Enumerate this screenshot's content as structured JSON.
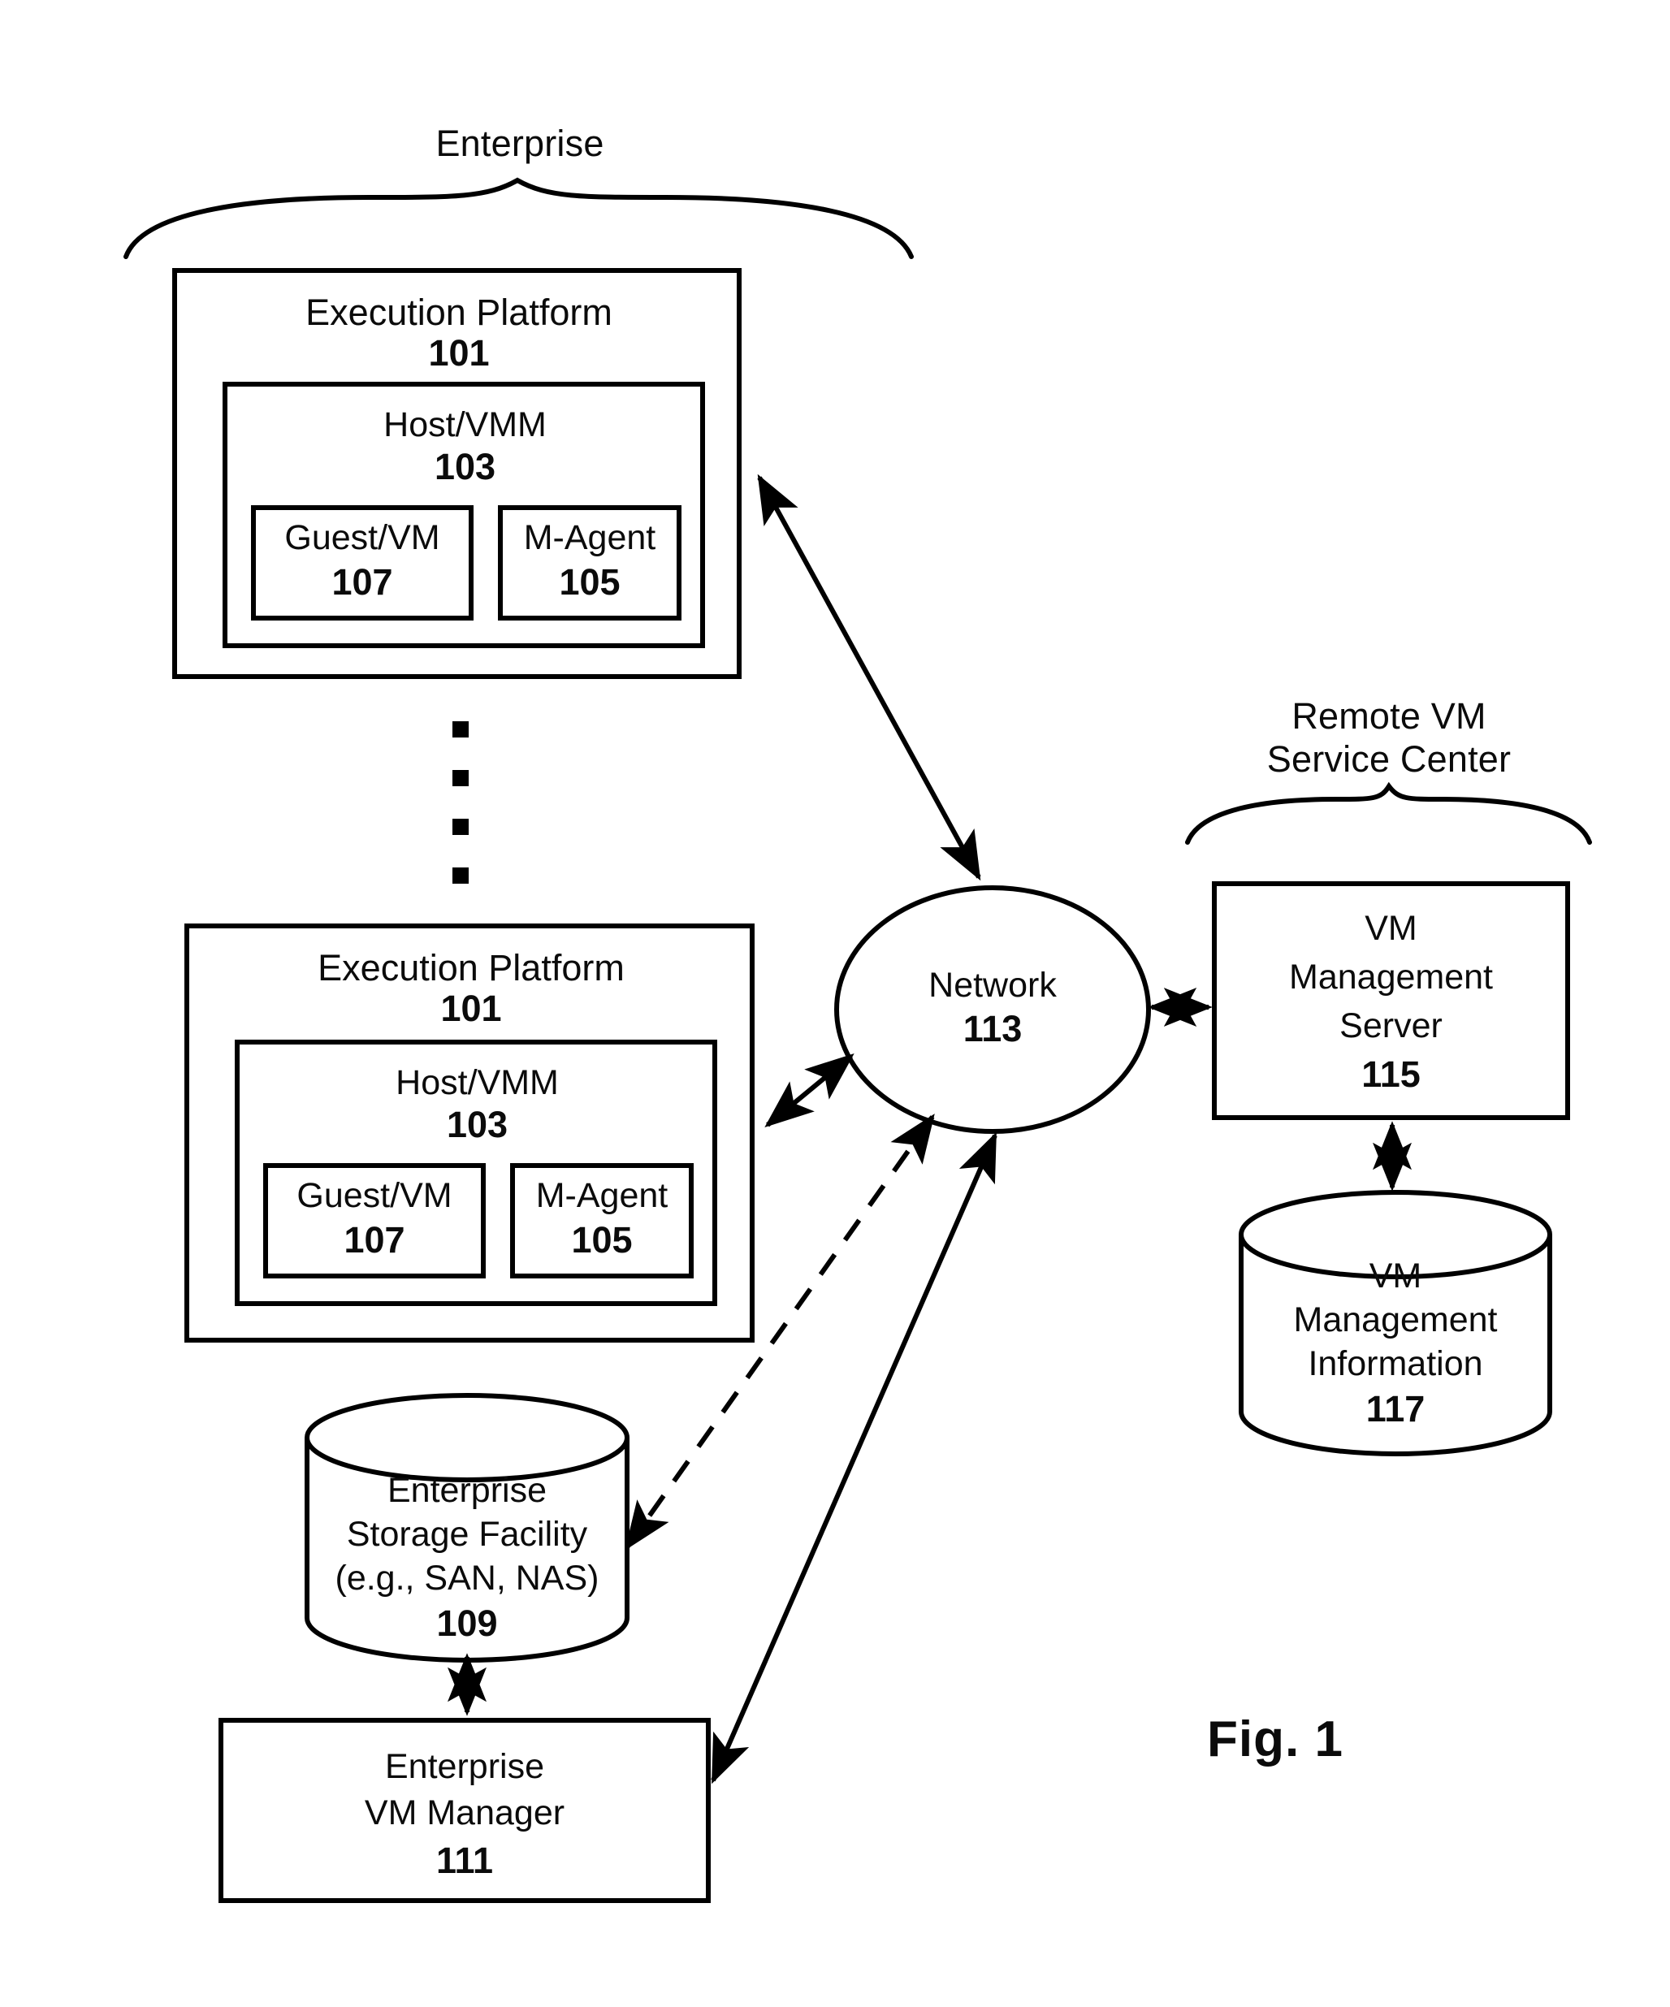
{
  "figure": {
    "label": "Fig. 1",
    "enterprise_group_label": "Enterprise",
    "remote_group_label_line1": "Remote VM",
    "remote_group_label_line2": "Service Center"
  },
  "execution_platforms": [
    {
      "title": "Execution Platform",
      "ref": "101",
      "host": {
        "title": "Host/VMM",
        "ref": "103",
        "children": [
          {
            "title": "Guest/VM",
            "ref": "107"
          },
          {
            "title": "M-Agent",
            "ref": "105"
          }
        ]
      }
    },
    {
      "title": "Execution Platform",
      "ref": "101",
      "host": {
        "title": "Host/VMM",
        "ref": "103",
        "children": [
          {
            "title": "Guest/VM",
            "ref": "107"
          },
          {
            "title": "M-Agent",
            "ref": "105"
          }
        ]
      }
    }
  ],
  "ellipsis_dots": 4,
  "network": {
    "title": "Network",
    "ref": "113"
  },
  "storage": {
    "line1": "Enterprise",
    "line2": "Storage Facility",
    "line3": "(e.g., SAN, NAS)",
    "ref": "109"
  },
  "enterprise_vm_manager": {
    "line1": "Enterprise",
    "line2": "VM Manager",
    "ref": "111"
  },
  "vm_management_server": {
    "line1": "VM",
    "line2": "Management",
    "line3": "Server",
    "ref": "115"
  },
  "vm_management_information": {
    "line1": "VM",
    "line2": "Management",
    "line3": "Information",
    "ref": "117"
  },
  "colors": {
    "stroke": "#000000",
    "background": "#ffffff"
  }
}
